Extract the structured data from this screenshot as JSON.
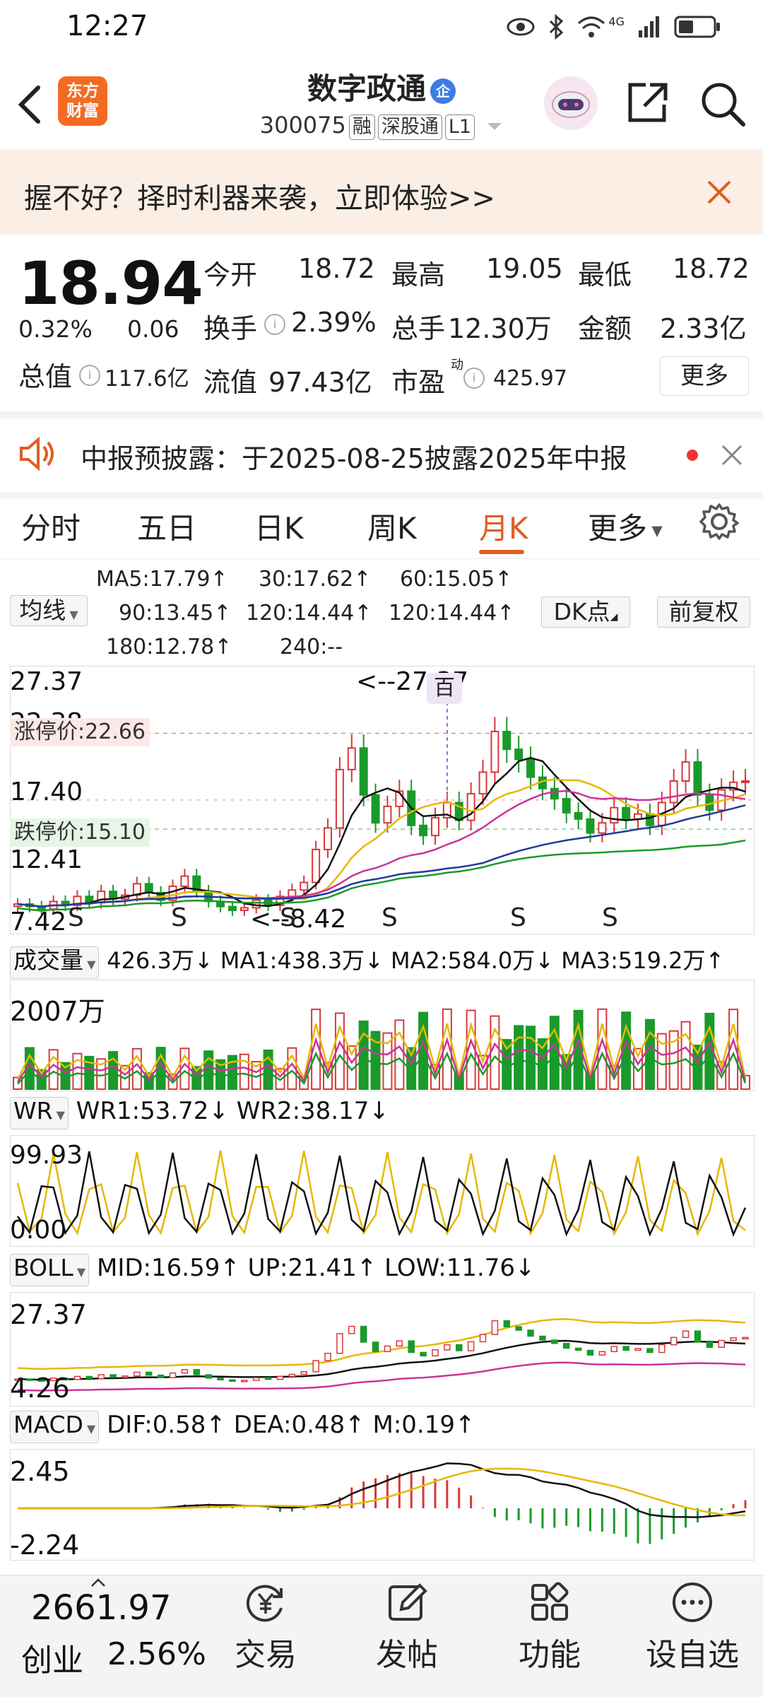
{
  "status": {
    "time": "12:27",
    "network": "4G"
  },
  "header": {
    "logo_text_1": "东方",
    "logo_text_2": "财富",
    "stock_name": "数字政通",
    "corp_badge": "企",
    "code": "300075",
    "tags": [
      "融",
      "深股通",
      "L1"
    ]
  },
  "promo": {
    "text": "握不好？择时利器来袭，立即体验>>"
  },
  "quote": {
    "price": "18.94",
    "change_pct": "0.32%",
    "change": "0.06",
    "open_label": "今开",
    "open": "18.72",
    "high_label": "最高",
    "high": "19.05",
    "low_label": "最低",
    "low": "18.72",
    "turnover_label": "换手",
    "turnover": "2.39%",
    "volume_label": "总手",
    "volume": "12.30万",
    "amount_label": "金额",
    "amount": "2.33亿",
    "mktcap_label": "总值",
    "mktcap": "117.6亿",
    "float_label": "流值",
    "float_cap": "97.43亿",
    "pe_label": "市盈",
    "pe_sup": "动",
    "pe": "425.97",
    "more_label": "更多"
  },
  "notice": {
    "text": "中报预披露：于2025-08-25披露2025年中报"
  },
  "tabs": [
    {
      "label": "分时"
    },
    {
      "label": "五日"
    },
    {
      "label": "日K"
    },
    {
      "label": "周K"
    },
    {
      "label": "月K"
    },
    {
      "label": "更多"
    }
  ],
  "ma_panel": {
    "selector": "均线",
    "ma5": "MA5:17.79↑",
    "ma30": "30:17.62↑",
    "ma60": "60:15.05↑",
    "ma90": "90:13.45↑",
    "ma120a": "120:14.44↑",
    "ma120b": "120:14.44↑",
    "ma180": "180:12.78↑",
    "ma240": "240:--",
    "dk_label": "DK点",
    "fq_label": "前复权"
  },
  "main_chart": {
    "y_labels": [
      "27.37",
      "22.38",
      "17.40",
      "12.41",
      "7.42"
    ],
    "limit_up": "涨停价:22.66",
    "limit_down": "跌停价:15.10",
    "max_marker": "<--27.37",
    "min_marker": "<--8.42",
    "event_marker": "百",
    "s_marks": [
      "S",
      "S",
      "S",
      "S",
      "S",
      "S"
    ]
  },
  "volume": {
    "selector": "成交量",
    "values_text": "426.3万↓  MA1:438.3万↓  MA2:584.0万↓  MA3:519.2万↑",
    "max_label": "2007万"
  },
  "wr": {
    "selector": "WR",
    "values_text": "WR1:53.72↓  WR2:38.17↓",
    "max_label": "99.93",
    "min_label": "0.00"
  },
  "boll": {
    "selector": "BOLL",
    "values_text": "MID:16.59↑  UP:21.41↑  LOW:11.76↓",
    "max_label": "27.37",
    "min_label": "4.26"
  },
  "macd": {
    "selector": "MACD",
    "values_text": "DIF:0.58↑  DEA:0.48↑  M:0.19↑",
    "max_label": "2.45",
    "min_label": "-2.24"
  },
  "bottom": {
    "index_value": "2661.97",
    "index_name": "创业",
    "index_change": "2.56%",
    "nav": [
      "交易",
      "发帖",
      "功能",
      "设自选"
    ]
  },
  "colors": {
    "up": "#d8383a",
    "down": "#1a9a2a",
    "accent": "#e05d23"
  }
}
